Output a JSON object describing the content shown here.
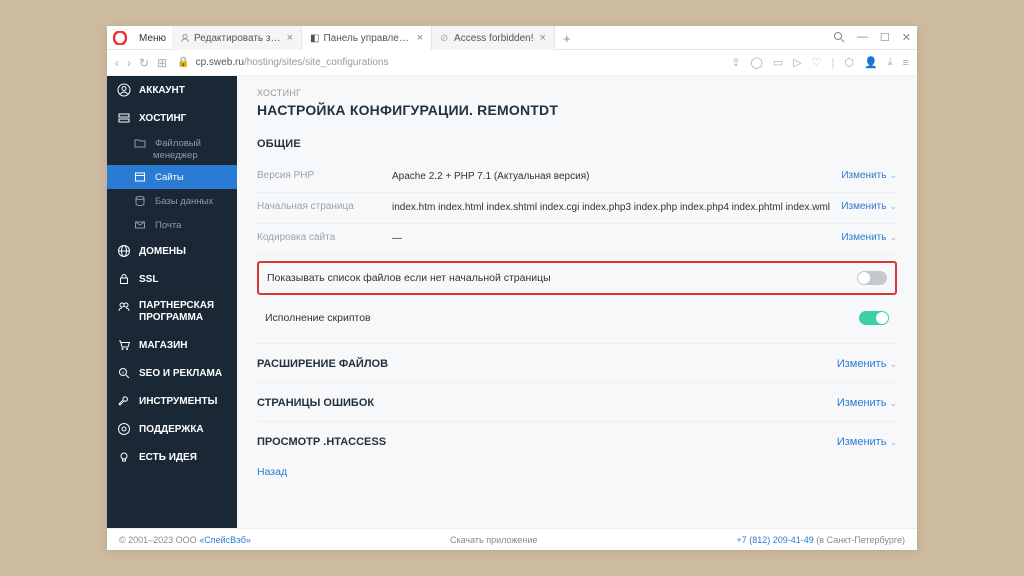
{
  "browser": {
    "menu": "Меню",
    "tabs": [
      {
        "label": "Редактировать запись \"Th",
        "active": false
      },
      {
        "label": "Панель управления VH",
        "active": true
      },
      {
        "label": "Access forbidden!",
        "active": false
      }
    ],
    "url_host": "cp.sweb.ru",
    "url_path": "/hosting/sites/site_configurations"
  },
  "sidebar": {
    "items": [
      {
        "label": "АККАУНТ"
      },
      {
        "label": "ХОСТИНГ"
      },
      {
        "label": "ДОМЕНЫ"
      },
      {
        "label": "SSL"
      },
      {
        "label": "ПАРТНЕРСКАЯ ПРОГРАММА"
      },
      {
        "label": "МАГАЗИН"
      },
      {
        "label": "SEO И РЕКЛАМА"
      },
      {
        "label": "ИНСТРУМЕНТЫ"
      },
      {
        "label": "ПОДДЕРЖКА"
      },
      {
        "label": "ЕСТЬ ИДЕЯ"
      }
    ],
    "subs": [
      {
        "label1": "Файловый",
        "label2": "менеджер"
      },
      {
        "label": "Сайты"
      },
      {
        "label": "Базы данных"
      },
      {
        "label": "Почта"
      }
    ]
  },
  "content": {
    "breadcrumb": "ХОСТИНГ",
    "title": "НАСТРОЙКА КОНФИГУРАЦИИ. REMONTDT",
    "section_common": "ОБЩИЕ",
    "rows": [
      {
        "label": "Версия PHP",
        "value": "Apache 2.2 + PHP 7.1 (Актуальная версия)",
        "action": "Изменить"
      },
      {
        "label": "Начальная страница",
        "value": "index.htm index.html index.shtml index.cgi index.php3 index.php index.php4 index.phtml index.wml",
        "action": "Изменить"
      },
      {
        "label": "Кодировка сайта",
        "value": "—",
        "action": "Изменить"
      }
    ],
    "toggles": [
      {
        "label": "Показывать список файлов если нет начальной страницы",
        "on": false,
        "highlight": true
      },
      {
        "label": "Исполнение скриптов",
        "on": true,
        "highlight": false
      }
    ],
    "collapse": [
      {
        "label": "РАСШИРЕНИЕ ФАЙЛОВ",
        "action": "Изменить"
      },
      {
        "label": "СТРАНИЦЫ ОШИБОК",
        "action": "Изменить"
      },
      {
        "label": "ПРОСМОТР .HTACCESS",
        "action": "Изменить"
      }
    ],
    "back": "Назад"
  },
  "footer": {
    "copyright": "© 2001–2023 ООО ",
    "company": "«СпейсВэб»",
    "download": "Скачать приложение",
    "phone": "+7 (812) 209-41-49",
    "city": " (в Санкт-Петербурге)"
  }
}
